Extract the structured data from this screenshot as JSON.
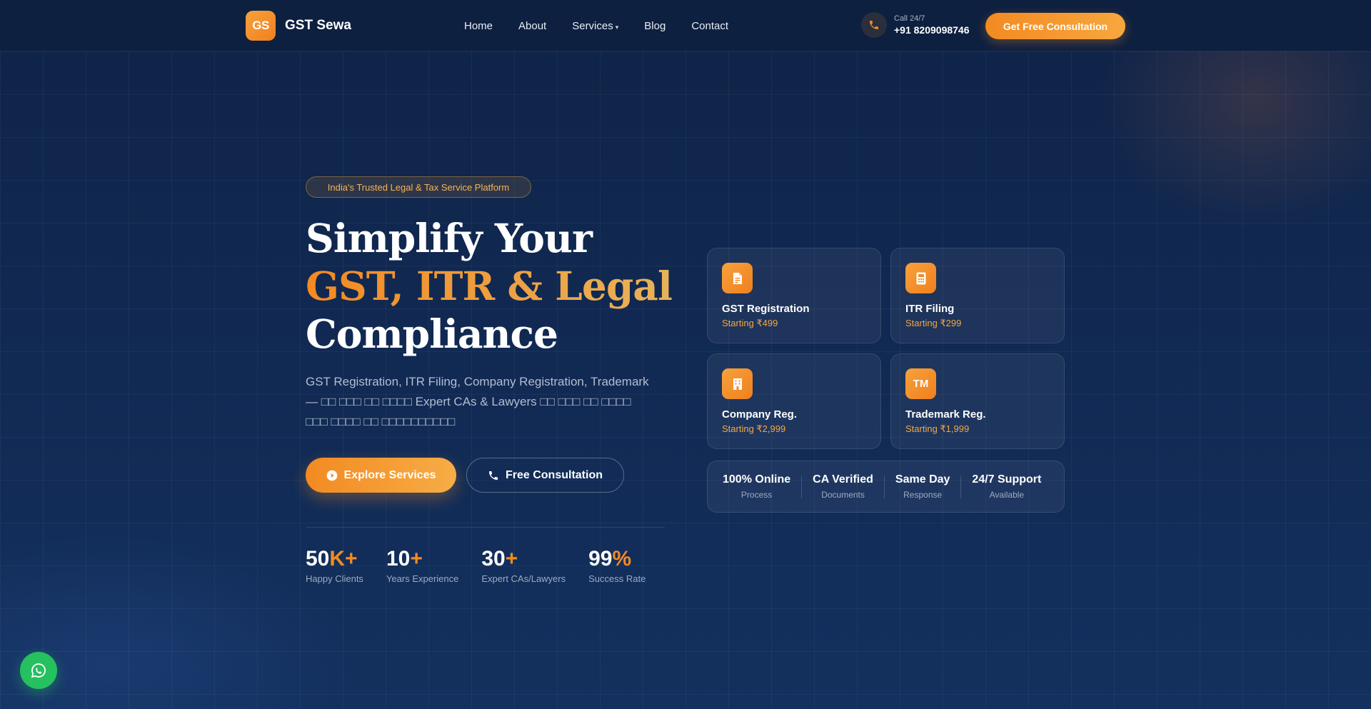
{
  "brand": {
    "logo_mark": "GS",
    "name": "GST Sewa",
    "accent_color": "#f38a22"
  },
  "nav": {
    "items": [
      {
        "label": "Home"
      },
      {
        "label": "About"
      },
      {
        "label": "Services"
      },
      {
        "label": "Blog"
      },
      {
        "label": "Contact"
      }
    ],
    "phone_caption": "Call 24/7",
    "phone_number": "+91 8209098746",
    "phone_icon": "phone-icon",
    "cta_label": "Get Free Consultation"
  },
  "hero": {
    "badge": "India's Trusted Legal & Tax Service Platform",
    "headline_line1": "Simplify Your",
    "headline_line2": "GST, ITR & Legal",
    "headline_line3": "Compliance",
    "description": "GST Registration, ITR Filing, Company Registration, Trademark — □□ □□□ □□ □□□□ Expert CAs & Lawyers □□ □□□ □□ □□□□ □□□ □□□□ □□ □□□□□□□□□□",
    "primary_button": "Explore Services",
    "primary_button_icon": "play-circle-icon",
    "secondary_button": "Free Consultation",
    "secondary_button_icon": "phone-icon",
    "stats": [
      {
        "number": "50",
        "suffix": "K+",
        "label": "Happy Clients"
      },
      {
        "number": "10",
        "suffix": "+",
        "label": "Years Experience"
      },
      {
        "number": "30",
        "suffix": "+",
        "label": "Expert CAs/Lawyers"
      },
      {
        "number": "99",
        "suffix": "%",
        "label": "Success Rate"
      }
    ]
  },
  "services": [
    {
      "title": "GST Registration",
      "price": "Starting ₹499",
      "icon": "document-icon"
    },
    {
      "title": "ITR Filing",
      "price": "Starting ₹299",
      "icon": "calculator-icon"
    },
    {
      "title": "Company Reg.",
      "price": "Starting ₹2,999",
      "icon": "building-icon"
    },
    {
      "title": "Trademark Reg.",
      "price": "Starting ₹1,999",
      "icon": "trademark-icon",
      "icon_text": "TM"
    }
  ],
  "features": [
    {
      "title": "100% Online",
      "subtitle": "Process"
    },
    {
      "title": "CA Verified",
      "subtitle": "Documents"
    },
    {
      "title": "Same Day",
      "subtitle": "Response"
    },
    {
      "title": "24/7 Support",
      "subtitle": "Available"
    }
  ],
  "whatsapp": {
    "icon": "whatsapp-icon",
    "color": "#25c15f"
  }
}
